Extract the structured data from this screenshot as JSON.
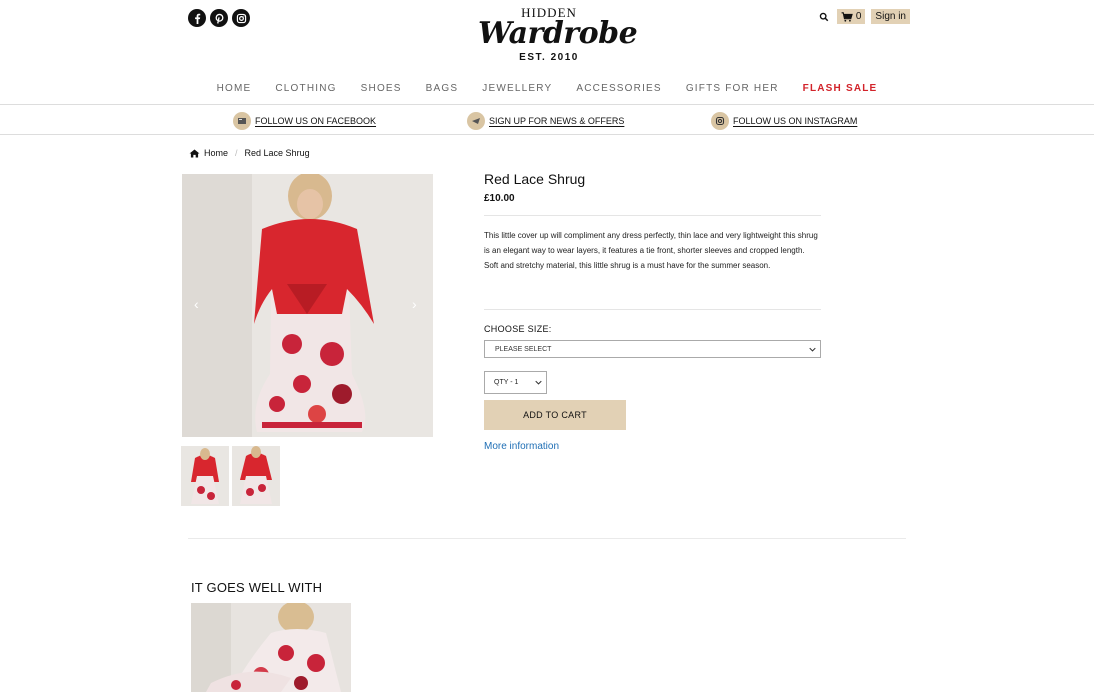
{
  "header": {
    "social_icons": [
      "facebook-icon",
      "pinterest-icon",
      "instagram-icon"
    ],
    "logo": {
      "line1": "HIDDEN",
      "line2": "Wardrobe",
      "line3": "EST. 2010"
    },
    "cart_count": "0",
    "signin_label": "Sign in"
  },
  "nav": {
    "items": [
      "HOME",
      "CLOTHING",
      "SHOES",
      "BAGS",
      "JEWELLERY",
      "ACCESSORIES",
      "GIFTS FOR HER",
      "FLASH SALE"
    ]
  },
  "promo": {
    "facebook": "FOLLOW US ON FACEBOOK",
    "newsletter": "SIGN UP FOR NEWS & OFFERS",
    "instagram": "FOLLOW US ON INSTAGRAM"
  },
  "breadcrumb": {
    "home": "Home",
    "current": "Red Lace Shrug"
  },
  "product": {
    "title": "Red Lace Shrug",
    "price": "£10.00",
    "description": "This little cover up will compliment any dress perfectly, thin lace and very lightweight this shrug is an elegant way to wear layers, it features a tie front, shorter sleeves and cropped length. Soft and stretchy material, this little shrug is a must have for the summer season.",
    "size_label": "CHOOSE SIZE:",
    "size_selected": "PLEASE SELECT",
    "qty_selected": "QTY - 1",
    "add_to_cart": "ADD TO CART",
    "more_info": "More information"
  },
  "related": {
    "title": "IT GOES WELL WITH"
  },
  "colors": {
    "accent": "#e2d1b5",
    "sale": "#d2232a",
    "link": "#1f6fb5"
  }
}
